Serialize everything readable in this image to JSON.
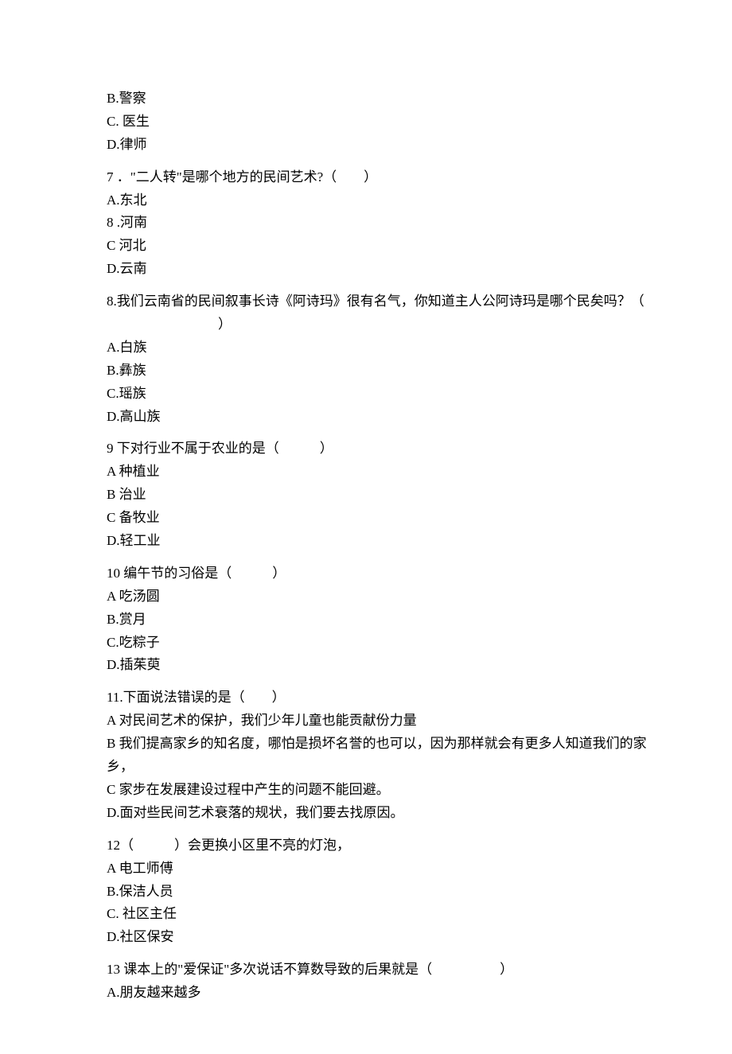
{
  "q6": {
    "optB": "B.警察",
    "optC": "C. 医生",
    "optD": "D.律师"
  },
  "q7": {
    "stem": "7 ．\"二人转\"是哪个地方的民间艺术?（　　）",
    "optA": "A.东北",
    "optB": "8 .河南",
    "optC": "C 河北",
    "optD": "D.云南"
  },
  "q8": {
    "stem": "8.我们云南省的民间叙事长诗《阿诗玛》很有名气，你知道主人公阿诗玛是哪个民矣吗？（",
    "paren": "）",
    "optA": "A.白族",
    "optB": "B.彝族",
    "optC": "C.瑶族",
    "optD": "D.高山族"
  },
  "q9": {
    "stem": "9 下对行业不属于农业的是（　　　）",
    "optA": "A 种植业",
    "optB": "B 治业",
    "optC": "C 备牧业",
    "optD": "D.轻工业"
  },
  "q10": {
    "stem": "10 编午节的习俗是（　　　）",
    "optA": "A 吃汤圆",
    "optB": "B.赏月",
    "optC": "C.吃粽子",
    "optD": "D.插茱萸"
  },
  "q11": {
    "stem": "11.下面说法错误的是（　　）",
    "optA": "A 对民间艺术的保护，我们少年儿童也能贡献份力量",
    "optB": "B 我们提高家乡的知名度，哪怕是损坏名誉的也可以，因为那样就会有更多人知道我们的家乡，",
    "optC": "C 家步在发展建设过程中产生的问题不能回避。",
    "optD": "D.面对些民间艺术衰落的规状，我们要去找原因。"
  },
  "q12": {
    "stem": "12（　　　）会更换小区里不亮的灯泡，",
    "optA": "A 电工师傅",
    "optB": "B.保洁人员",
    "optC": "C. 社区主任",
    "optD": "D.社区保安"
  },
  "q13": {
    "stem": "13 课本上的\"爱保证\"多次说话不算数导致的后果就是（　　　　　）",
    "optA": "A.朋友越来越多"
  }
}
